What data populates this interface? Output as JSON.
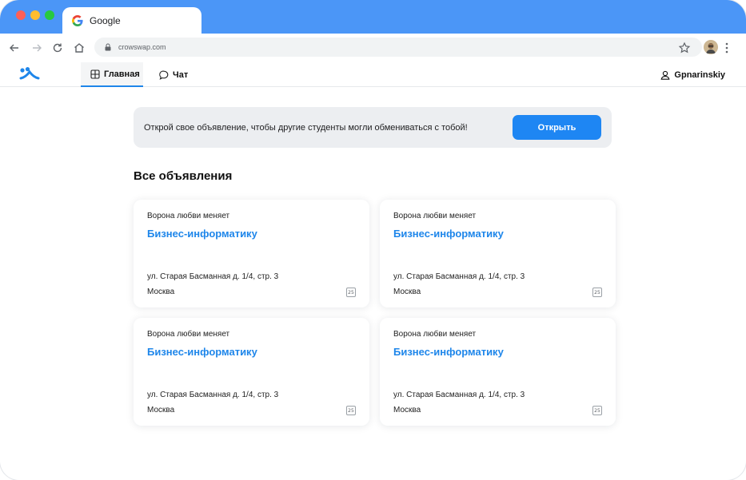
{
  "browser": {
    "tab_title": "Google",
    "url": "crowswap.com",
    "colors": {
      "titlebar": "#4b96f7",
      "accent": "#1e86ea"
    }
  },
  "header": {
    "nav": [
      {
        "label": "Главная",
        "icon": "grid-icon",
        "active": true
      },
      {
        "label": "Чат",
        "icon": "chat-bubble-icon",
        "active": false
      }
    ],
    "user": {
      "name": "Gpnarinskiy",
      "icon": "user-icon"
    }
  },
  "banner": {
    "text": "Открой свое объявление, чтобы другие студенты могли обмениваться с тобой!",
    "button_label": "Открыть"
  },
  "listings": {
    "title": "Все объявления",
    "items": [
      {
        "who": "Ворона любви меняет",
        "subject": "Бизнес-информатику",
        "address": "ул. Старая Басманная д. 1/4, стр. 3",
        "city": "Москва",
        "date_badge": "25"
      },
      {
        "who": "Ворона любви меняет",
        "subject": "Бизнес-информатику",
        "address": "ул. Старая Басманная д. 1/4, стр. 3",
        "city": "Москва",
        "date_badge": "25"
      },
      {
        "who": "Ворона любви меняет",
        "subject": "Бизнес-информатику",
        "address": "ул. Старая Басманная д. 1/4, стр. 3",
        "city": "Москва",
        "date_badge": "25"
      },
      {
        "who": "Ворона любви меняет",
        "subject": "Бизнес-информатику",
        "address": "ул. Старая Басманная д. 1/4, стр. 3",
        "city": "Москва",
        "date_badge": "25"
      }
    ]
  }
}
